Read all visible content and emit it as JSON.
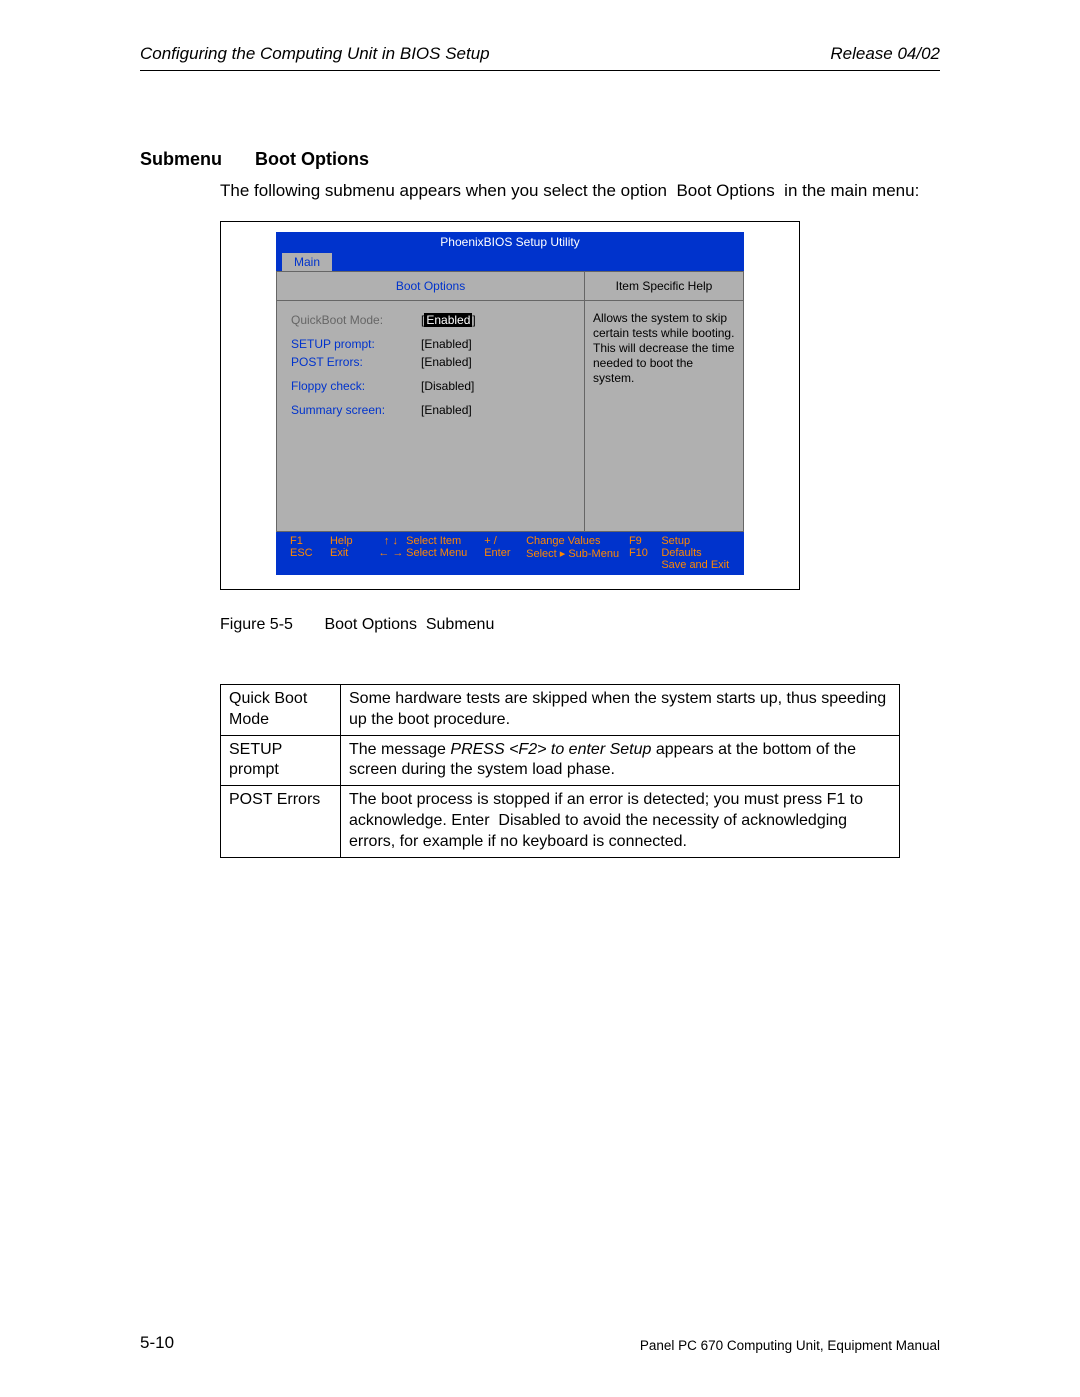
{
  "header": {
    "left": "Configuring the Computing Unit in BIOS Setup",
    "right": "Release 04/02"
  },
  "section": {
    "label": "Submenu",
    "title": "Boot Options",
    "intro": "The following submenu appears when you select the option  Boot Options  in the main menu:"
  },
  "bios": {
    "title": "PhoenixBIOS Setup Utility",
    "tab": "Main",
    "left_header": "Boot Options",
    "right_header": "Item Specific Help",
    "help_text": "Allows the system to skip certain tests while booting. This will decrease the time needed to boot the system.",
    "options": [
      {
        "label": "QuickBoot Mode:",
        "value": "Enabled",
        "label_color": "grey",
        "selected": true,
        "gap": false
      },
      {
        "label": "SETUP prompt:",
        "value": "[Enabled]",
        "label_color": "blue",
        "selected": false,
        "gap": true
      },
      {
        "label": "POST Errors:",
        "value": "[Enabled]",
        "label_color": "blue",
        "selected": false,
        "gap": false
      },
      {
        "label": "Floppy check:",
        "value": "[Disabled]",
        "label_color": "blue",
        "selected": false,
        "gap": true
      },
      {
        "label": "Summary screen:",
        "value": "[Enabled]",
        "label_color": "blue",
        "selected": false,
        "gap": true
      }
    ],
    "footer": {
      "c1a": "F1",
      "c1b": "ESC",
      "c2a": "Help",
      "c2b": "Exit",
      "c3a": "↑ ↓",
      "c3b": "← →",
      "c4a": "Select Item",
      "c4b": "Select Menu",
      "c5a": "+ /",
      "c5b": "Enter",
      "c6a": "Change Values",
      "c6b": "Select ▸ Sub-Menu",
      "c7a": "F9",
      "c7b": "F10",
      "c8a": "Setup Defaults",
      "c8b": "Save and Exit"
    }
  },
  "figure": {
    "num": "Figure 5-5",
    "caption": "Boot Options  Submenu"
  },
  "table": {
    "rows": [
      {
        "label": "Quick Boot Mode",
        "desc_parts": [
          {
            "text": "Some hardware tests are skipped when the system starts up, thus speeding up the boot procedure.",
            "ital": false
          }
        ]
      },
      {
        "label": "SETUP prompt",
        "desc_parts": [
          {
            "text": "The message ",
            "ital": false
          },
          {
            "text": "PRESS <F2> to enter Setup ",
            "ital": true
          },
          {
            "text": "appears at the bottom of the screen during the system load phase.",
            "ital": false
          }
        ]
      },
      {
        "label": "POST Errors",
        "desc_parts": [
          {
            "text": "The boot process is stopped if an error is detected; you must press F1 to acknowledge. Enter  Disabled to avoid the necessity of acknowledging errors, for example if no keyboard is connected.",
            "ital": false
          }
        ]
      }
    ]
  },
  "footer": {
    "page": "5-10",
    "manual": "Panel PC 670 Computing Unit, Equipment Manual"
  }
}
